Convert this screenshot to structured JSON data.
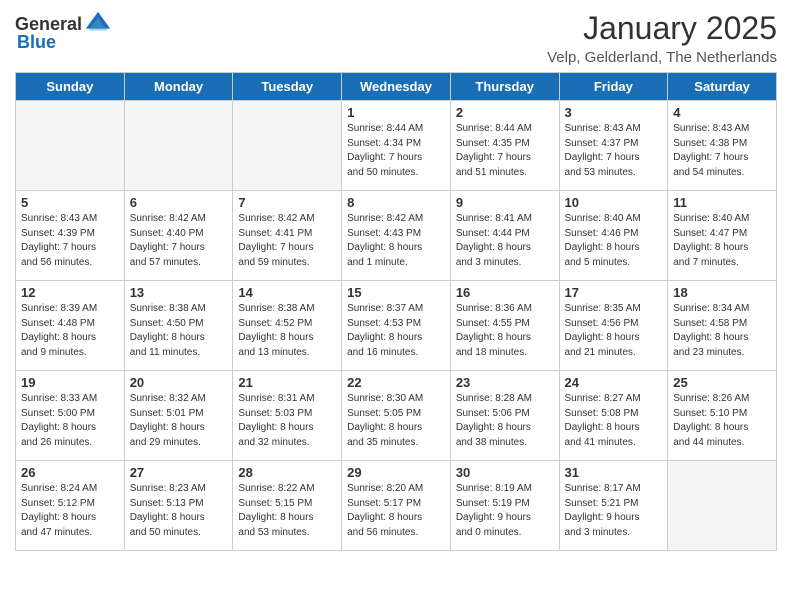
{
  "header": {
    "logo_general": "General",
    "logo_blue": "Blue",
    "title": "January 2025",
    "location": "Velp, Gelderland, The Netherlands"
  },
  "weekdays": [
    "Sunday",
    "Monday",
    "Tuesday",
    "Wednesday",
    "Thursday",
    "Friday",
    "Saturday"
  ],
  "weeks": [
    [
      {
        "day": "",
        "info": ""
      },
      {
        "day": "",
        "info": ""
      },
      {
        "day": "",
        "info": ""
      },
      {
        "day": "1",
        "info": "Sunrise: 8:44 AM\nSunset: 4:34 PM\nDaylight: 7 hours\nand 50 minutes."
      },
      {
        "day": "2",
        "info": "Sunrise: 8:44 AM\nSunset: 4:35 PM\nDaylight: 7 hours\nand 51 minutes."
      },
      {
        "day": "3",
        "info": "Sunrise: 8:43 AM\nSunset: 4:37 PM\nDaylight: 7 hours\nand 53 minutes."
      },
      {
        "day": "4",
        "info": "Sunrise: 8:43 AM\nSunset: 4:38 PM\nDaylight: 7 hours\nand 54 minutes."
      }
    ],
    [
      {
        "day": "5",
        "info": "Sunrise: 8:43 AM\nSunset: 4:39 PM\nDaylight: 7 hours\nand 56 minutes."
      },
      {
        "day": "6",
        "info": "Sunrise: 8:42 AM\nSunset: 4:40 PM\nDaylight: 7 hours\nand 57 minutes."
      },
      {
        "day": "7",
        "info": "Sunrise: 8:42 AM\nSunset: 4:41 PM\nDaylight: 7 hours\nand 59 minutes."
      },
      {
        "day": "8",
        "info": "Sunrise: 8:42 AM\nSunset: 4:43 PM\nDaylight: 8 hours\nand 1 minute."
      },
      {
        "day": "9",
        "info": "Sunrise: 8:41 AM\nSunset: 4:44 PM\nDaylight: 8 hours\nand 3 minutes."
      },
      {
        "day": "10",
        "info": "Sunrise: 8:40 AM\nSunset: 4:46 PM\nDaylight: 8 hours\nand 5 minutes."
      },
      {
        "day": "11",
        "info": "Sunrise: 8:40 AM\nSunset: 4:47 PM\nDaylight: 8 hours\nand 7 minutes."
      }
    ],
    [
      {
        "day": "12",
        "info": "Sunrise: 8:39 AM\nSunset: 4:48 PM\nDaylight: 8 hours\nand 9 minutes."
      },
      {
        "day": "13",
        "info": "Sunrise: 8:38 AM\nSunset: 4:50 PM\nDaylight: 8 hours\nand 11 minutes."
      },
      {
        "day": "14",
        "info": "Sunrise: 8:38 AM\nSunset: 4:52 PM\nDaylight: 8 hours\nand 13 minutes."
      },
      {
        "day": "15",
        "info": "Sunrise: 8:37 AM\nSunset: 4:53 PM\nDaylight: 8 hours\nand 16 minutes."
      },
      {
        "day": "16",
        "info": "Sunrise: 8:36 AM\nSunset: 4:55 PM\nDaylight: 8 hours\nand 18 minutes."
      },
      {
        "day": "17",
        "info": "Sunrise: 8:35 AM\nSunset: 4:56 PM\nDaylight: 8 hours\nand 21 minutes."
      },
      {
        "day": "18",
        "info": "Sunrise: 8:34 AM\nSunset: 4:58 PM\nDaylight: 8 hours\nand 23 minutes."
      }
    ],
    [
      {
        "day": "19",
        "info": "Sunrise: 8:33 AM\nSunset: 5:00 PM\nDaylight: 8 hours\nand 26 minutes."
      },
      {
        "day": "20",
        "info": "Sunrise: 8:32 AM\nSunset: 5:01 PM\nDaylight: 8 hours\nand 29 minutes."
      },
      {
        "day": "21",
        "info": "Sunrise: 8:31 AM\nSunset: 5:03 PM\nDaylight: 8 hours\nand 32 minutes."
      },
      {
        "day": "22",
        "info": "Sunrise: 8:30 AM\nSunset: 5:05 PM\nDaylight: 8 hours\nand 35 minutes."
      },
      {
        "day": "23",
        "info": "Sunrise: 8:28 AM\nSunset: 5:06 PM\nDaylight: 8 hours\nand 38 minutes."
      },
      {
        "day": "24",
        "info": "Sunrise: 8:27 AM\nSunset: 5:08 PM\nDaylight: 8 hours\nand 41 minutes."
      },
      {
        "day": "25",
        "info": "Sunrise: 8:26 AM\nSunset: 5:10 PM\nDaylight: 8 hours\nand 44 minutes."
      }
    ],
    [
      {
        "day": "26",
        "info": "Sunrise: 8:24 AM\nSunset: 5:12 PM\nDaylight: 8 hours\nand 47 minutes."
      },
      {
        "day": "27",
        "info": "Sunrise: 8:23 AM\nSunset: 5:13 PM\nDaylight: 8 hours\nand 50 minutes."
      },
      {
        "day": "28",
        "info": "Sunrise: 8:22 AM\nSunset: 5:15 PM\nDaylight: 8 hours\nand 53 minutes."
      },
      {
        "day": "29",
        "info": "Sunrise: 8:20 AM\nSunset: 5:17 PM\nDaylight: 8 hours\nand 56 minutes."
      },
      {
        "day": "30",
        "info": "Sunrise: 8:19 AM\nSunset: 5:19 PM\nDaylight: 9 hours\nand 0 minutes."
      },
      {
        "day": "31",
        "info": "Sunrise: 8:17 AM\nSunset: 5:21 PM\nDaylight: 9 hours\nand 3 minutes."
      },
      {
        "day": "",
        "info": ""
      }
    ]
  ]
}
